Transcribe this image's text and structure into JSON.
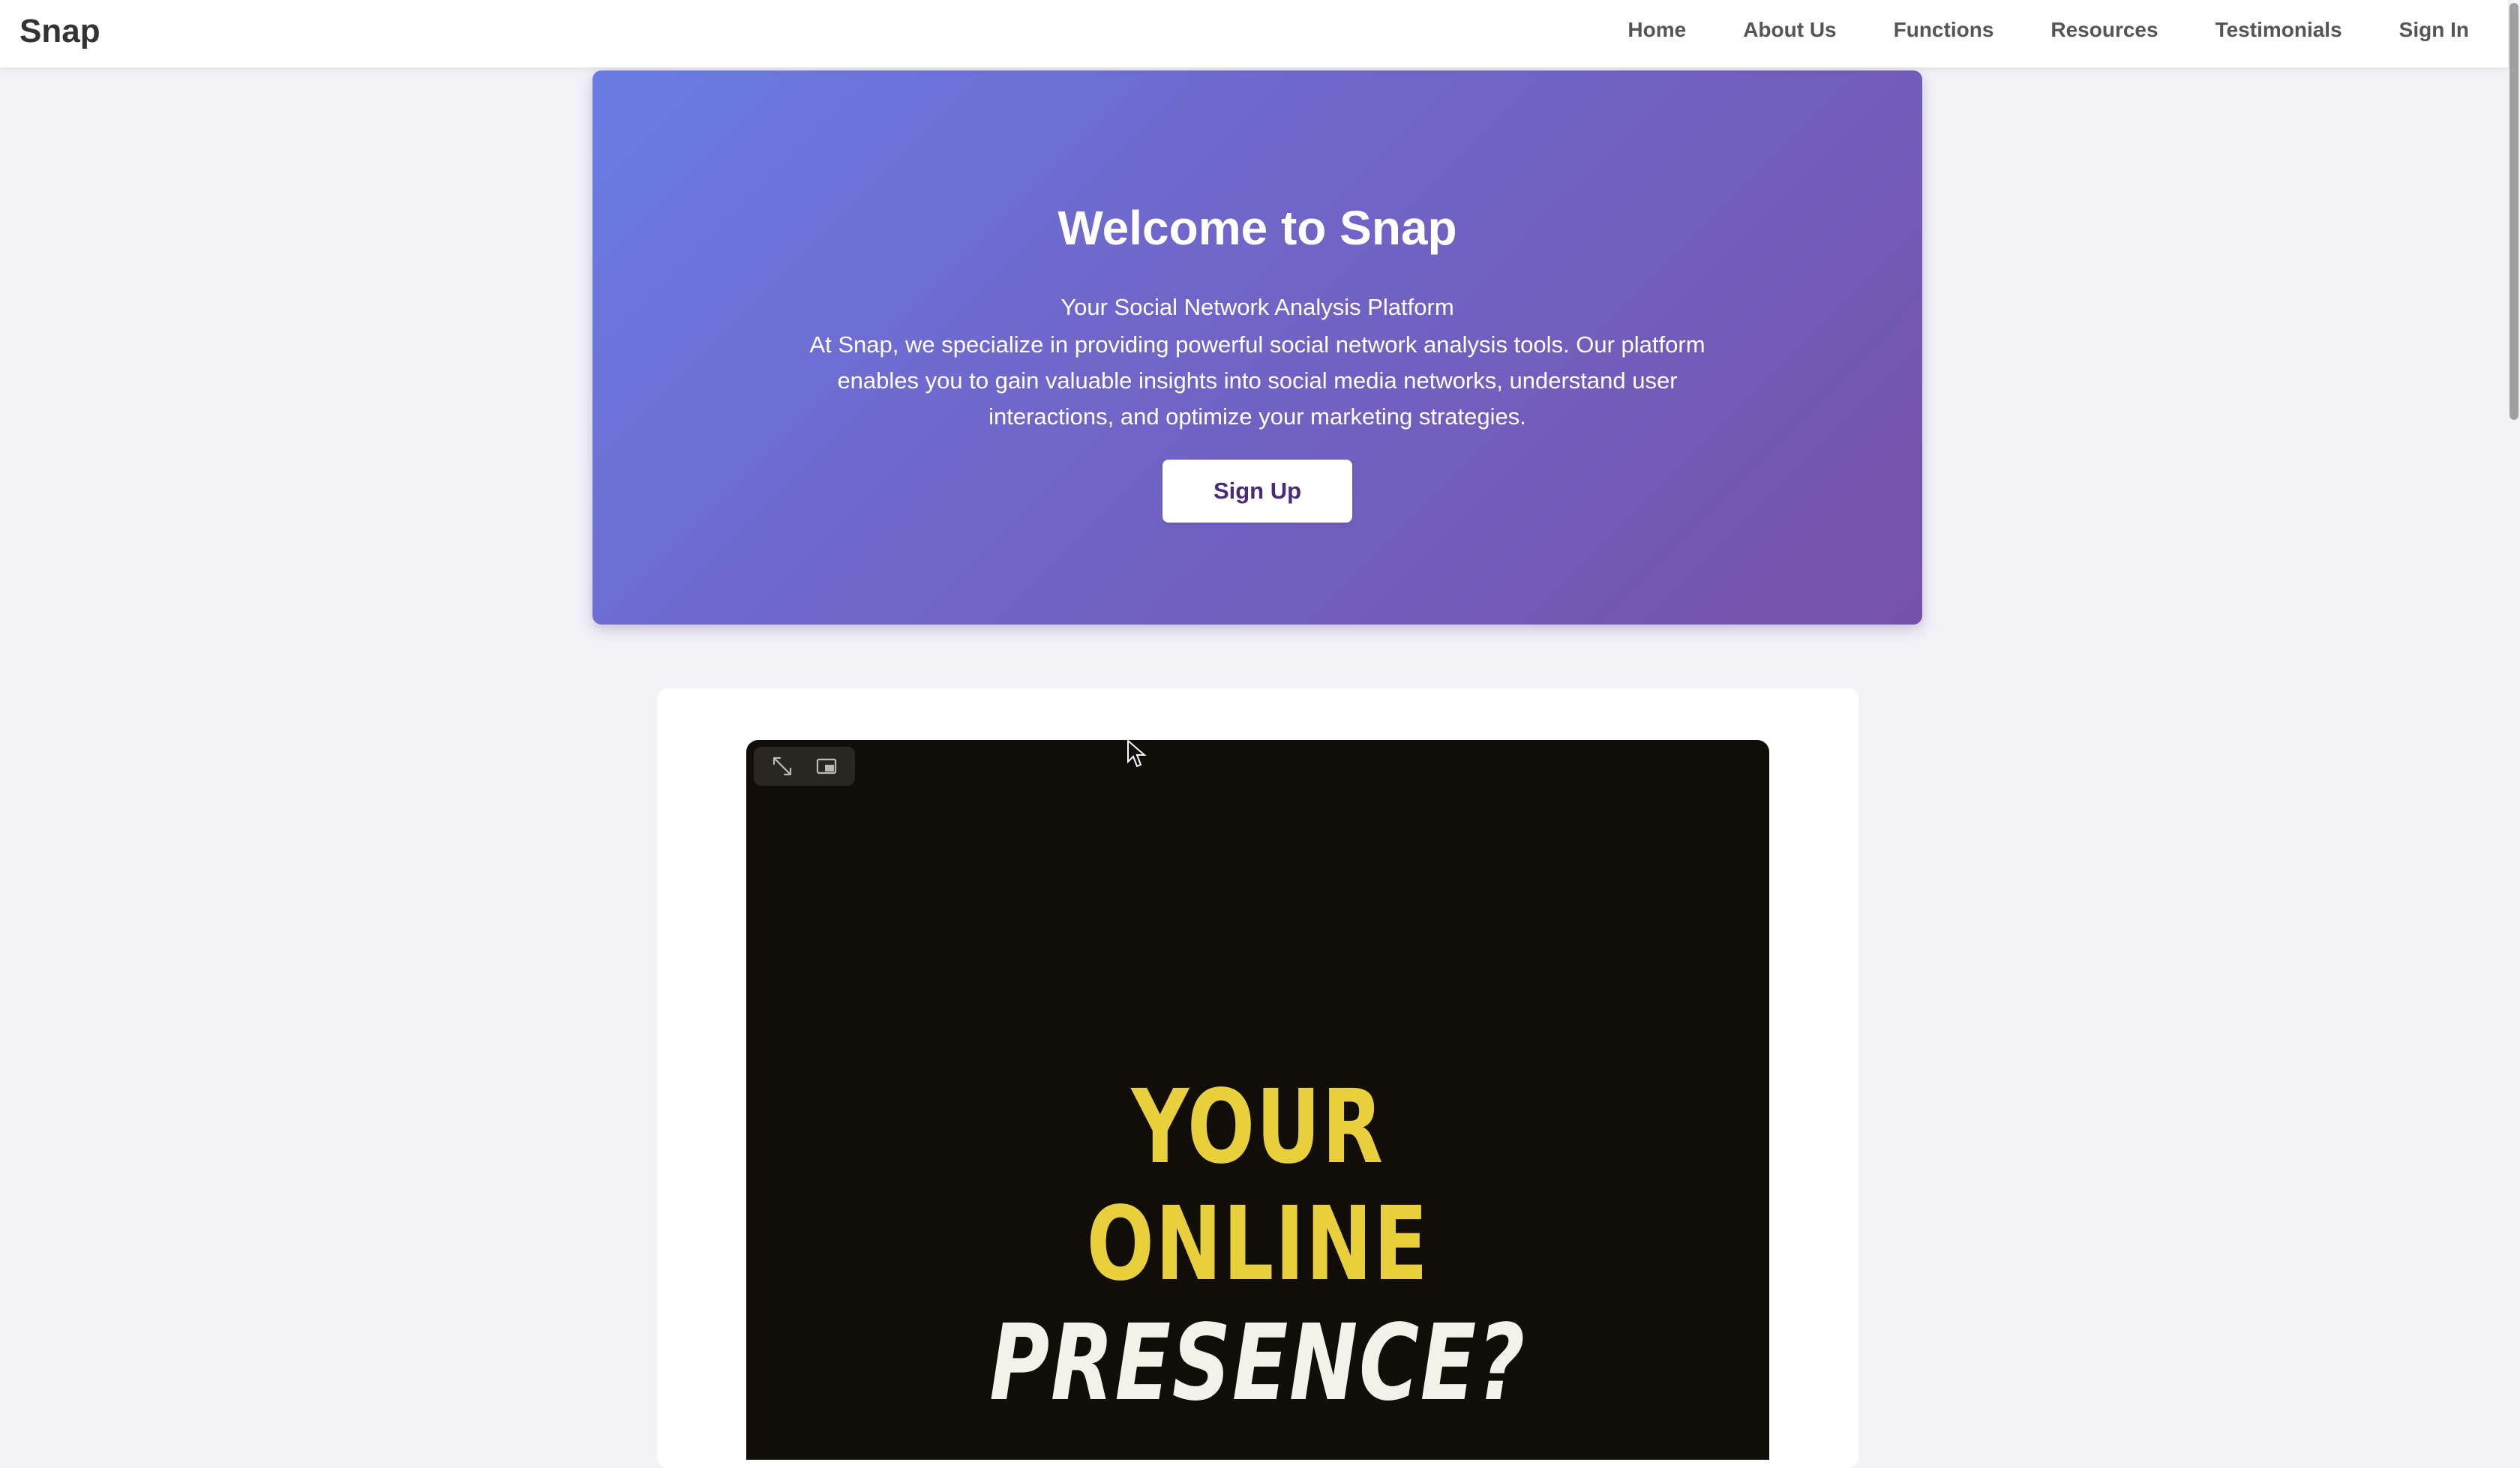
{
  "navbar": {
    "brand": "Snap",
    "links": [
      "Home",
      "About Us",
      "Functions",
      "Resources",
      "Testimonials",
      "Sign In"
    ]
  },
  "hero": {
    "title": "Welcome to Snap",
    "subtitle": "Your Social Network Analysis Platform",
    "body": "At Snap, we specialize in providing powerful social network analysis tools. Our platform enables you to gain valuable insights into social media networks, understand user interactions, and optimize your marketing strategies.",
    "cta_label": "Sign Up",
    "gradient_start": "#6a7de3",
    "gradient_end": "#7552a9"
  },
  "video": {
    "line1": "YOUR",
    "line2": "ONLINE",
    "line3": "PRESENCE?",
    "controls": [
      "expand-icon",
      "picture-in-picture-icon"
    ],
    "text_color_primary": "#e8cf3c",
    "text_color_secondary": "#f4f1e8",
    "background": "#110d08"
  }
}
